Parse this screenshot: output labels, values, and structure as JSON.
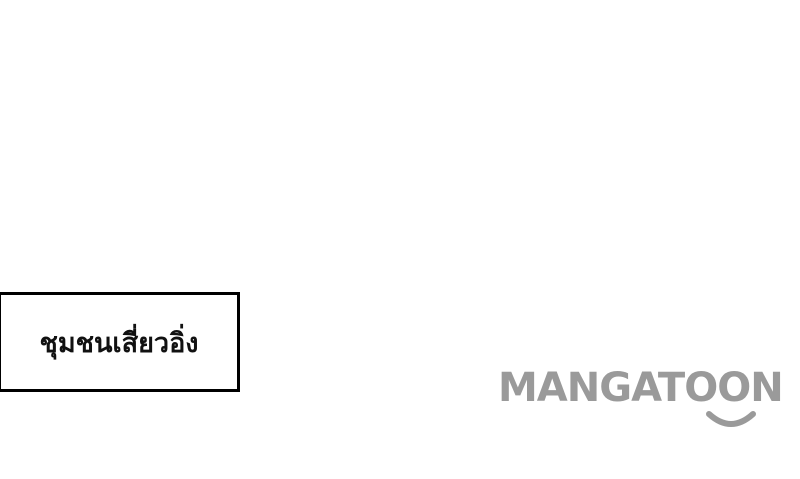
{
  "caption": {
    "text": "ชุมชนเสี่ยวอิ่ง"
  },
  "watermark": {
    "brand": "MANGATOON",
    "color": "#9a9a9a",
    "smile_icon": "smile-icon"
  }
}
